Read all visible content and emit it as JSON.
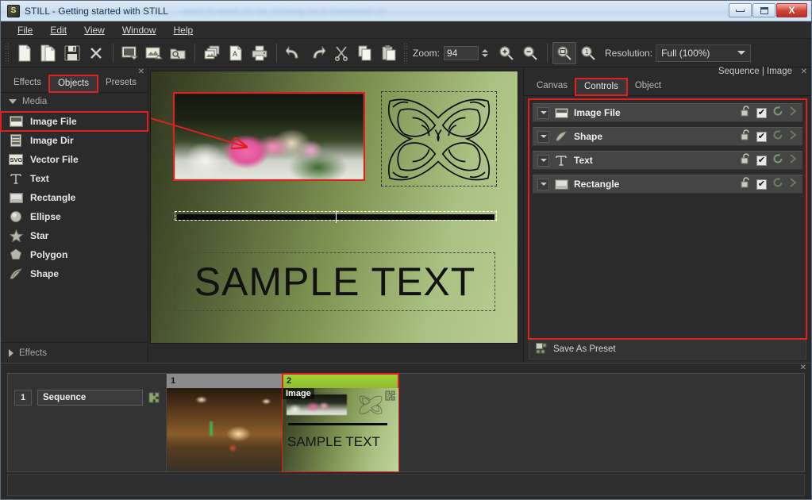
{
  "window": {
    "app_icon": "still-app-icon",
    "title": "STILL - Getting started with STILL",
    "blurred_text": "want to work on by clicking on a thumbnail in",
    "minimize_label": "Minimize",
    "maximize_label": "Maximize",
    "close_label": "X"
  },
  "menubar": {
    "items": [
      {
        "label": "File"
      },
      {
        "label": "Edit"
      },
      {
        "label": "View"
      },
      {
        "label": "Window"
      },
      {
        "label": "Help"
      }
    ]
  },
  "toolbar": {
    "icons": [
      {
        "name": "new-file-icon",
        "title": "New"
      },
      {
        "name": "new-copy-icon",
        "title": "New from copy"
      },
      {
        "name": "save-icon",
        "title": "Save"
      },
      {
        "name": "close-x-icon",
        "title": "Close"
      },
      {
        "name": "import-image-icon",
        "title": "Import image"
      },
      {
        "name": "export-image-icon",
        "title": "Export image"
      },
      {
        "name": "open-folder-icon",
        "title": "Open folder"
      },
      {
        "name": "batch-images-icon",
        "title": "Batch"
      },
      {
        "name": "render-page-icon",
        "title": "Render"
      },
      {
        "name": "print-icon",
        "title": "Print"
      },
      {
        "name": "undo-icon",
        "title": "Undo"
      },
      {
        "name": "redo-icon",
        "title": "Redo"
      },
      {
        "name": "cut-scissors-icon",
        "title": "Cut"
      },
      {
        "name": "copy-icon",
        "title": "Copy"
      },
      {
        "name": "paste-icon",
        "title": "Paste"
      }
    ],
    "zoom_label": "Zoom:",
    "zoom_value": "94",
    "zoom_in_icon": "zoom-in-icon",
    "zoom_out_icon": "zoom-out-icon",
    "zoom_fit_icon": "zoom-fit-icon",
    "zoom_actual_icon": "zoom-actual-size-icon",
    "resolution_label": "Resolution:",
    "resolution_value": "Full (100%)"
  },
  "left_panel": {
    "tabs": [
      {
        "label": "Effects",
        "active": false
      },
      {
        "label": "Objects",
        "active": true,
        "highlighted": true
      },
      {
        "label": "Presets",
        "active": false
      }
    ],
    "media_group": {
      "label": "Media",
      "expanded": true
    },
    "objects": [
      {
        "label": "Image File",
        "icon": "image-file-icon",
        "selected": true
      },
      {
        "label": "Image Dir",
        "icon": "image-dir-icon",
        "selected": false
      },
      {
        "label": "Vector File",
        "icon": "vector-file-icon",
        "selected": false
      },
      {
        "label": "Text",
        "icon": "text-icon",
        "selected": false
      },
      {
        "label": "Rectangle",
        "icon": "rectangle-icon",
        "selected": false
      },
      {
        "label": "Ellipse",
        "icon": "ellipse-icon",
        "selected": false
      },
      {
        "label": "Star",
        "icon": "star-icon",
        "selected": false
      },
      {
        "label": "Polygon",
        "icon": "polygon-icon",
        "selected": false
      },
      {
        "label": "Shape",
        "icon": "shape-icon",
        "selected": false
      }
    ],
    "effects_group": {
      "label": "Effects",
      "expanded": false
    }
  },
  "canvas": {
    "sample_text": "SAMPLE TEXT"
  },
  "right_panel": {
    "header_label": "Sequence | Image",
    "close_label": "✕",
    "tabs": [
      {
        "label": "Canvas",
        "active": false
      },
      {
        "label": "Controls",
        "active": true,
        "highlighted": true
      },
      {
        "label": "Object",
        "active": false
      }
    ],
    "rows": [
      {
        "label": "Image File",
        "icon": "image-file-icon",
        "locked": false,
        "enabled": true
      },
      {
        "label": "Shape",
        "icon": "shape-icon",
        "locked": false,
        "enabled": true
      },
      {
        "label": "Text",
        "icon": "text-icon",
        "locked": false,
        "enabled": true
      },
      {
        "label": "Rectangle",
        "icon": "rectangle-icon",
        "locked": false,
        "enabled": true
      }
    ],
    "row_icons": {
      "expand": "chevron-down-icon",
      "lock": "unlock-icon",
      "check": "✔",
      "reset": "reset-circular-arrow-icon",
      "next": "chevron-right-icon"
    },
    "save_preset_label": "Save As Preset",
    "save_preset_icon": "save-preset-icon"
  },
  "timeline": {
    "close_label": "✕",
    "sequence_number": "1",
    "sequence_name": "Sequence",
    "puzzle_icon": "puzzle-piece-icon",
    "thumbnails": [
      {
        "number": "1",
        "label": "",
        "selected": false,
        "kind": "tunnel"
      },
      {
        "number": "2",
        "label": "Image",
        "selected": true,
        "kind": "card",
        "card_text": "SAMPLE TEXT"
      }
    ]
  },
  "colors": {
    "highlight_red": "#e01f1f",
    "selected_green": "#a4d23a",
    "panel_bg": "#2b2b2b",
    "titlebar_blue": "#cfe0f2"
  }
}
